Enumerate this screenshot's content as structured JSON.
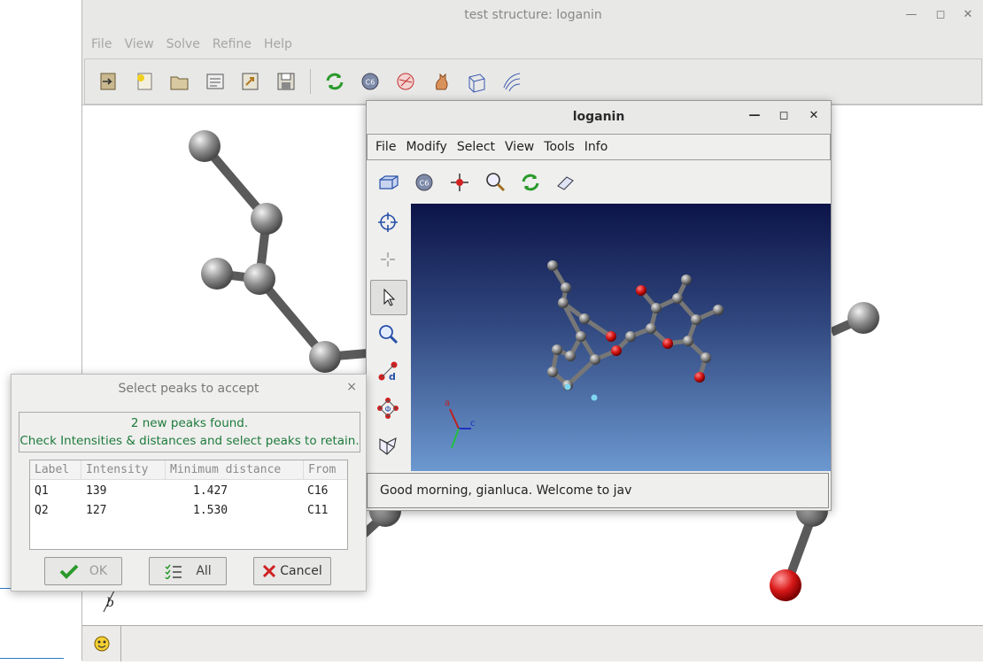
{
  "main_window": {
    "title": "test structure: loganin",
    "menu": [
      "File",
      "View",
      "Solve",
      "Refine",
      "Help"
    ],
    "toolbar_icons": [
      "open-icon",
      "new-icon",
      "folder-icon",
      "document-icon",
      "export-icon",
      "save-icon",
      "refresh-icon",
      "element-c6-icon",
      "structure-icon",
      "cat-icon",
      "cell-icon",
      "wave-icon"
    ],
    "axis_label": "b",
    "status_icon": "smiley-icon"
  },
  "loganin_window": {
    "title": "loganin",
    "menu": [
      "File",
      "Modify",
      "Select",
      "View",
      "Tools",
      "Info"
    ],
    "toolbar_icons": [
      "unit-cell-icon",
      "element-icon",
      "atom-center-icon",
      "zoom-search-icon",
      "refresh-icon",
      "eraser-icon"
    ],
    "side_icons": [
      "target-icon",
      "crosshair-icon",
      "pointer-icon",
      "zoom-icon",
      "distance-icon",
      "angle-icon",
      "rotate-icon"
    ],
    "axes": {
      "a": "a",
      "c": "c"
    },
    "status": "Good morning, gianluca.  Welcome to jav"
  },
  "dialog": {
    "title": "Select peaks to accept",
    "close": "×",
    "message_line1": "2 new peaks found.",
    "message_line2": "Check Intensities & distances and select peaks to retain.",
    "columns": [
      "Label",
      "Intensity",
      "Minimum distance",
      "From"
    ],
    "rows": [
      {
        "label": "Q1",
        "intensity": "139",
        "distance": "1.427",
        "from": "C16"
      },
      {
        "label": "Q2",
        "intensity": "127",
        "distance": "1.530",
        "from": "C11"
      }
    ],
    "buttons": {
      "ok": "OK",
      "all": "All",
      "cancel": "Cancel"
    }
  },
  "colors": {
    "atom_gray": "#8a8a8a",
    "atom_red": "#d81818",
    "peak_cyan": "#7fd6f0",
    "message_green": "#1d7a3a"
  }
}
